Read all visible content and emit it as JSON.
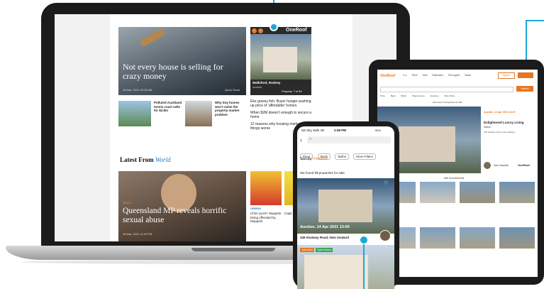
{
  "laptop": {
    "hero_headline": "Not every house is selling for crazy money",
    "hero_date": "18 Mar, 2021 05:28 AM",
    "hero_read": "Quick Read",
    "oneroof_logo": "OneRoof",
    "listing_location": "Wallsford, Rodney",
    "listing_type": "Auction",
    "listing_counter": "Property 7 of 94",
    "side_story_1": "Eke grassy fish: Buyer hunger pushing up price of ‘affordable’ homes",
    "side_story_2": "When $2M doesn’t enough to secure a home",
    "side_story_3": "12 reasons why housing market made things worse",
    "mid_story_1_title": "Polluted Auckland tennis court sells for $2.8m",
    "mid_story_2_title": "Why tiny homes won’t solve the property market problem",
    "latest_label": "Latest From",
    "latest_section": "World",
    "world_headline": "Queensland MP reveals horrific sexual abuse",
    "world_date": "18 Mar, 2021 11:20 PM",
    "world_kicker": "NEWS",
    "small_story_1": "Chris Lynch: Muppets being offended by Muppets",
    "small_story_2": "Capti... after 200...",
    "small_kicker": "OPINION"
  },
  "tablet": {
    "logo": "OneRoof",
    "nav": [
      "Buy",
      "Rent",
      "Sold",
      "Estimates",
      "Find agent",
      "News"
    ],
    "sign_in": "Sign in",
    "search_btn": "Search",
    "filters": [
      "Price",
      "Beds",
      "Baths",
      "Property type",
      "Features",
      "More filters"
    ],
    "result_count": "We found 72 properties for sale",
    "card_date": "Auction, 14 Apr 2021 13:00",
    "card_title": "Enlightened Luxury Living",
    "card_subtitle": "Saturn",
    "card_address": "349 Kiwiway Road, New Zealand",
    "agent_name": "Sam Campbell",
    "recommend_title": "We recommend"
  },
  "phone": {
    "carrier": "NZ Sky Safe",
    "network": "4G",
    "time": "2:49 PM",
    "battery": "55%",
    "filters": [
      "Price",
      "Beds",
      "Baths",
      "More Filters"
    ],
    "sort_label": "Sort by:",
    "sort_value": "Featured",
    "result_prefix": "We found",
    "result_count": "72",
    "result_suffix": "properties for sale",
    "card_date": "Auction, 14 Apr 2021 13:00",
    "card_address": "349 Kiwiway Road, New Zealand",
    "badge_1": "Just listed",
    "badge_2": "Open homes"
  },
  "colors": {
    "callout": "#1ba8d9",
    "accent": "#e8761f"
  }
}
